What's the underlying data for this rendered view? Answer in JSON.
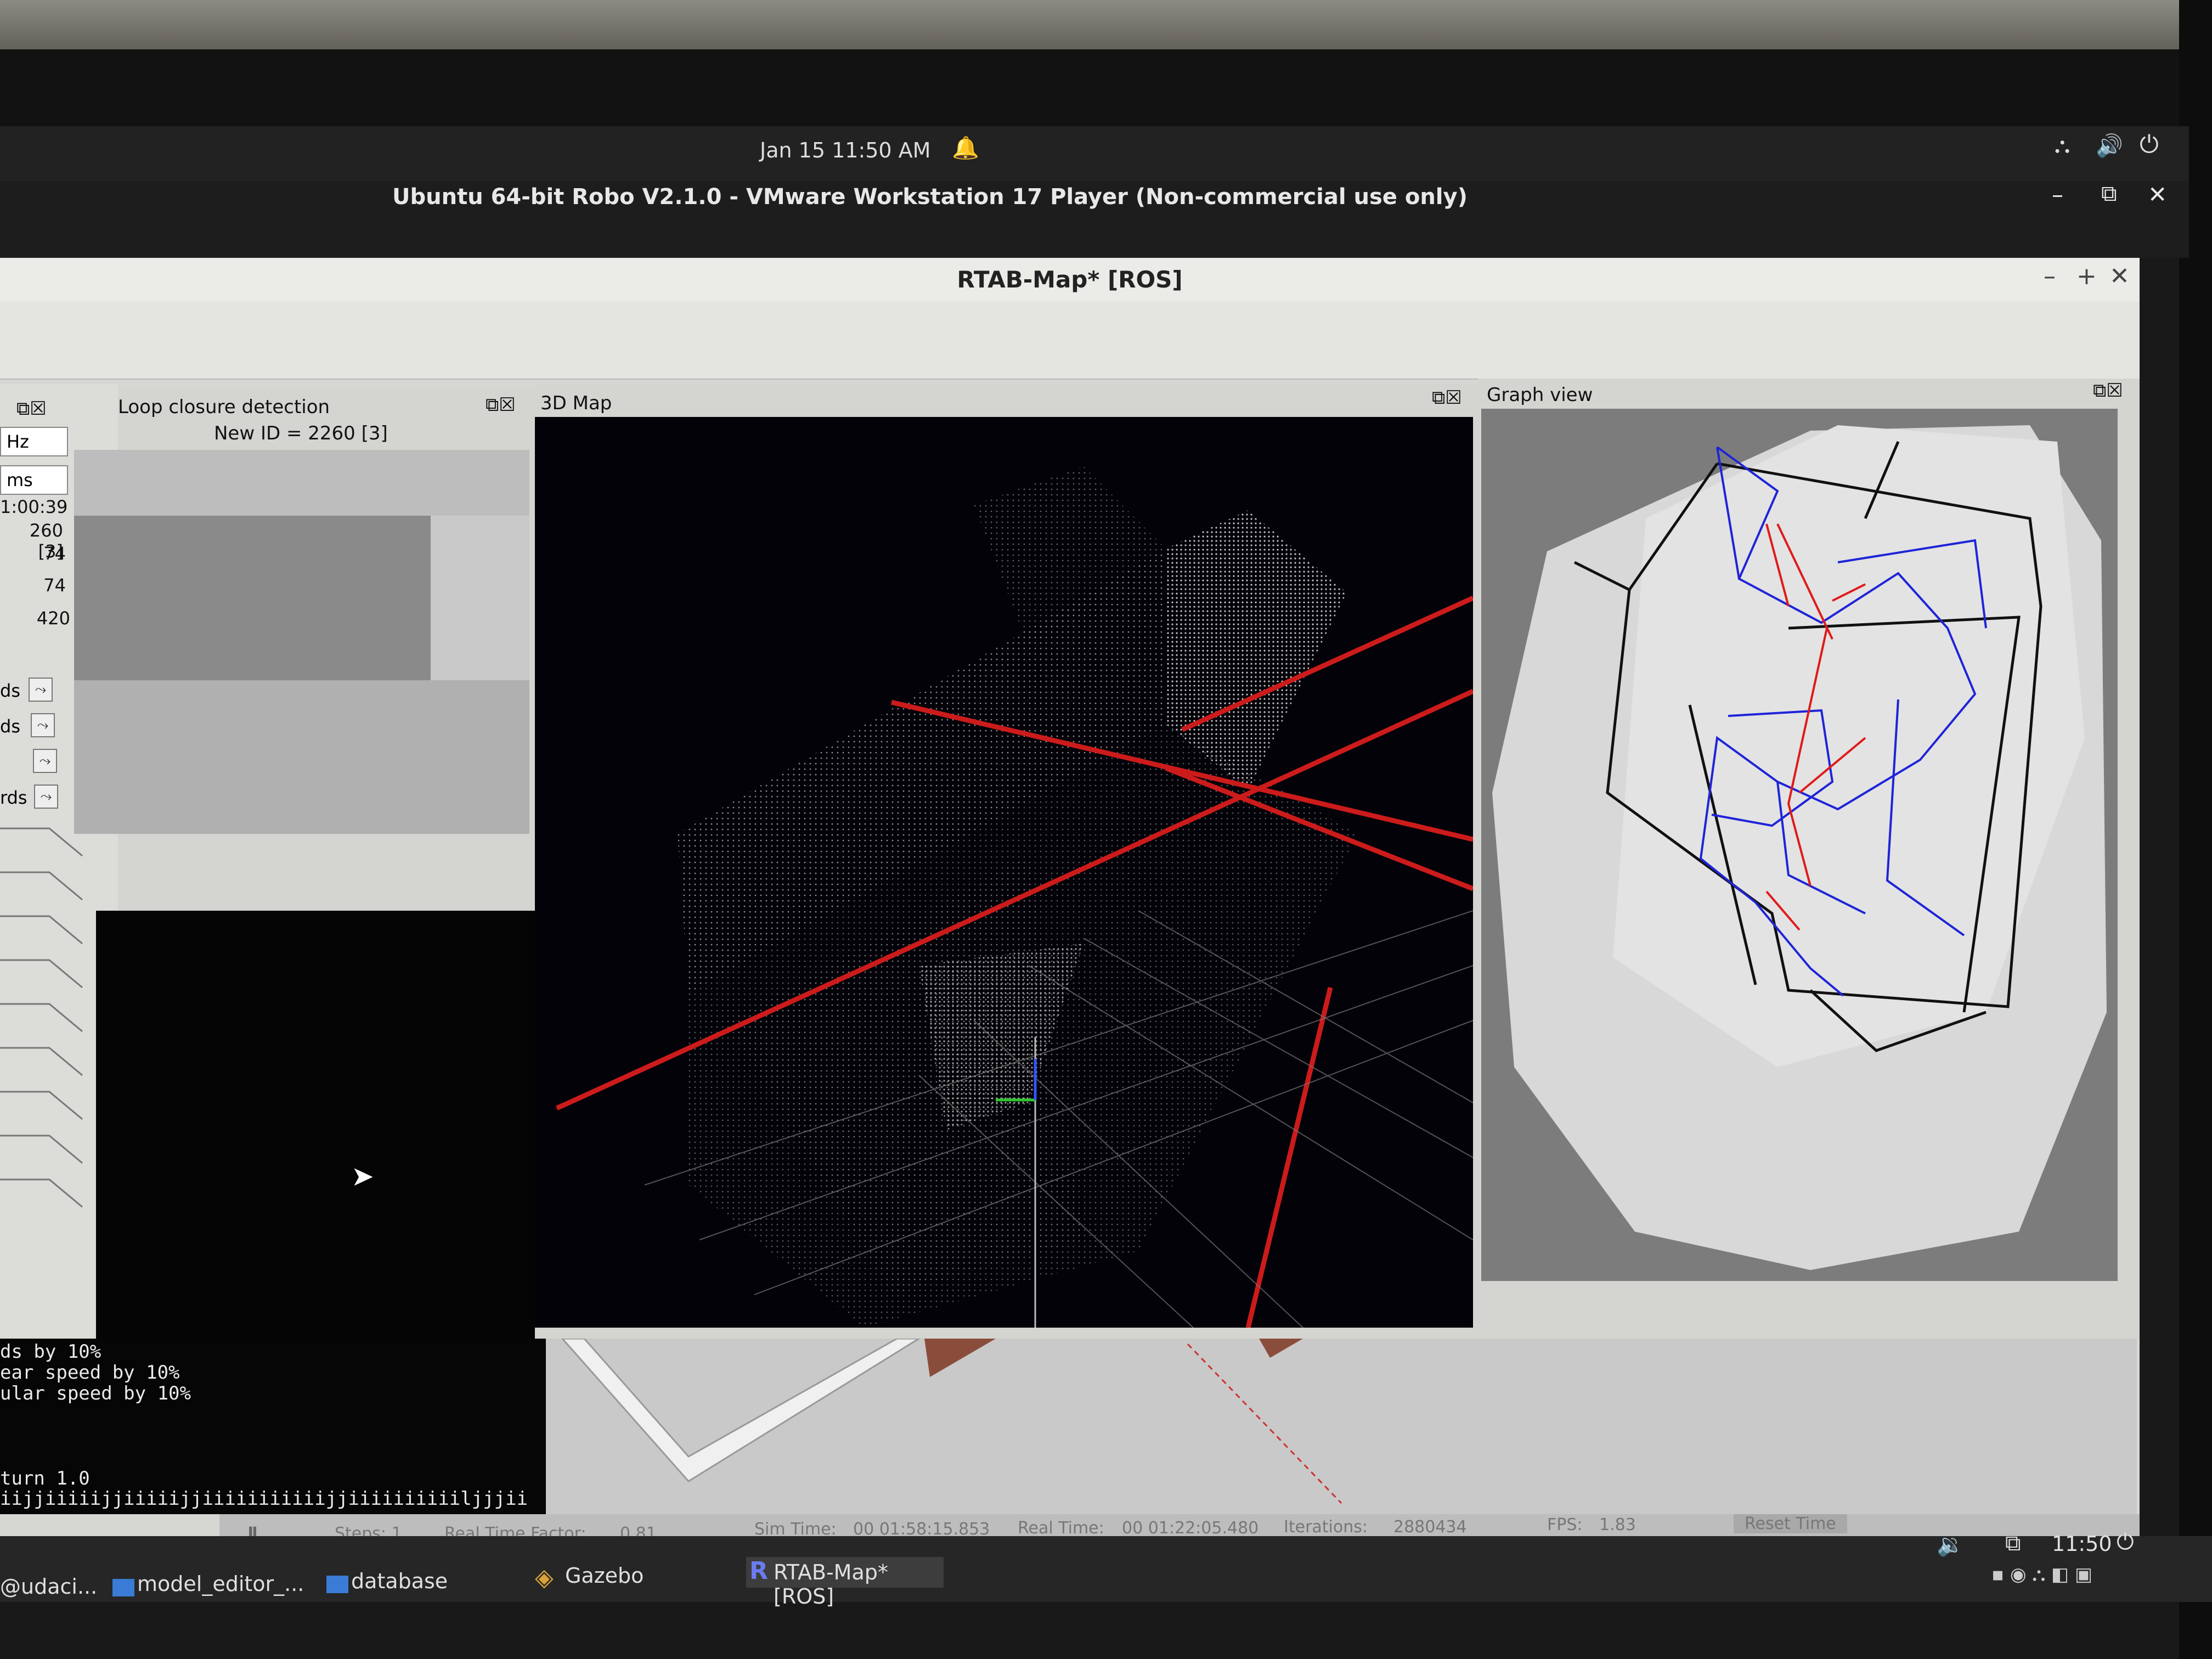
{
  "topbar": {
    "clock": "Jan 15  11:50 AM",
    "bell_icon": "bell-icon",
    "tray_icons": [
      "network-icon",
      "volume-icon",
      "power-icon"
    ]
  },
  "vm_window": {
    "title": "Ubuntu 64-bit Robo V2.1.0 - VMware Workstation 17 Player (Non-commercial use only)",
    "controls": [
      "–",
      "⧉",
      "✕"
    ]
  },
  "rtabmap": {
    "title": "RTAB-Map* [ROS]",
    "controls": [
      "–",
      "+",
      "✕"
    ],
    "loop_closure": {
      "header": "Loop closure detection",
      "new_id": "New ID = 2260 [3]"
    },
    "left_panel": {
      "spin_hz": "Hz",
      "spin_ms": "ms",
      "values": [
        "1:00:39",
        "260 [3]",
        "74",
        "74",
        "420"
      ],
      "plot_labels": [
        "ds",
        "ds",
        "",
        "rds"
      ]
    },
    "map3d": {
      "header": "3D Map"
    },
    "graph_view": {
      "header": "Graph view"
    }
  },
  "terminal": {
    "lines": [
      "ds by 10%",
      "ear speed by 10%",
      "ular speed by 10%",
      "",
      "",
      "",
      "turn 1.0",
      "iijjiiiiijjiiiiijjiiiiiiiiiiijjiiiiiiiiiiljjjii"
    ]
  },
  "gazebo_status": {
    "steps": "Steps: 1",
    "rtf_label": "Real Time Factor:",
    "rtf_value": "0.81",
    "sim_time_label": "Sim Time:",
    "sim_time": "00 01:58:15.853",
    "real_time_label": "Real Time:",
    "real_time": "00 01:22:05.480",
    "iterations_label": "Iterations:",
    "iterations": "2880434",
    "fps_label": "FPS:",
    "fps": "1.83",
    "reset": "Reset Time"
  },
  "taskbar": {
    "items": [
      "@udaci...",
      "model_editor_...",
      "database",
      "Gazebo",
      "RTAB-Map* [ROS]"
    ],
    "clock": "11:50"
  }
}
